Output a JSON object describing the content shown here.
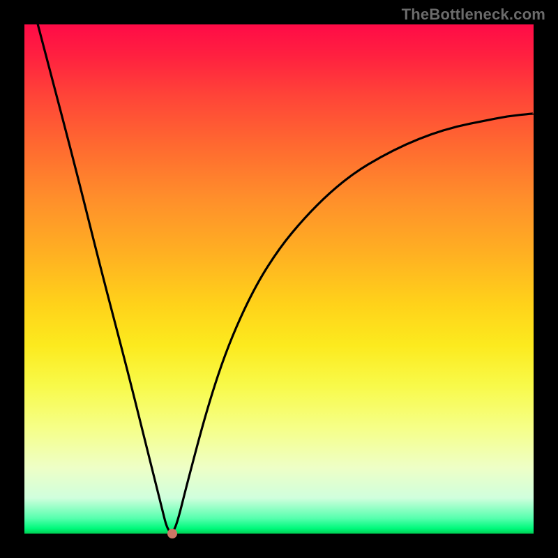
{
  "watermark": "TheBottleneck.com",
  "chart_data": {
    "type": "line",
    "title": "",
    "xlabel": "",
    "ylabel": "",
    "xlim": [
      0,
      100
    ],
    "ylim": [
      0,
      100
    ],
    "grid": false,
    "series": [
      {
        "name": "bottleneck-curve",
        "x": [
          0,
          5,
          10,
          15,
          20,
          24,
          26,
          27,
          28,
          29,
          30,
          32,
          36,
          40,
          45,
          50,
          55,
          60,
          65,
          70,
          75,
          80,
          85,
          90,
          95,
          100
        ],
        "values": [
          110,
          91,
          72,
          52,
          33,
          17,
          9,
          5,
          1,
          0,
          2,
          10,
          25,
          37,
          48,
          56,
          62,
          67,
          71,
          74,
          76.5,
          78.5,
          80,
          81,
          82,
          82.5
        ]
      }
    ],
    "marker": {
      "x": 29,
      "y": 0,
      "color": "#cc7766"
    },
    "gradient_stops": [
      {
        "pos": 0,
        "color": "#ff0b47"
      },
      {
        "pos": 50,
        "color": "#ffd21a"
      },
      {
        "pos": 80,
        "color": "#f6ff86"
      },
      {
        "pos": 100,
        "color": "#00cf54"
      }
    ]
  }
}
